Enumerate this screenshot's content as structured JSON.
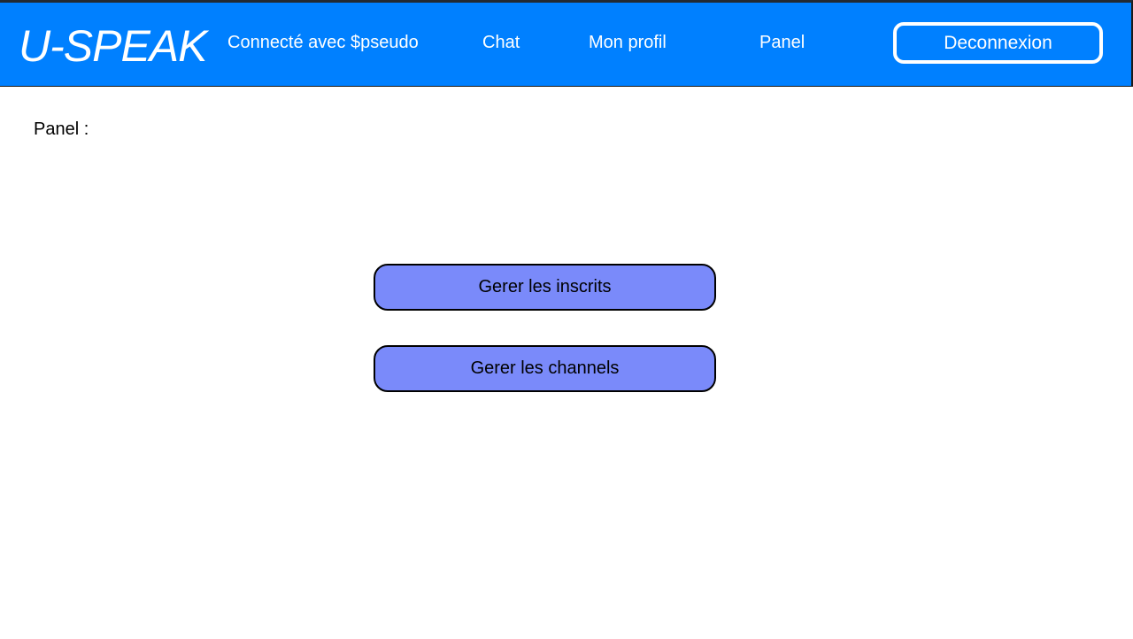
{
  "header": {
    "logo": "U-SPEAK",
    "connected_label": "Connecté avec $pseudo",
    "nav": {
      "chat": "Chat",
      "profil": "Mon profil",
      "panel": "Panel"
    },
    "logout_label": "Deconnexion"
  },
  "main": {
    "title": "Panel :",
    "actions": {
      "inscrits": "Gerer les inscrits",
      "channels": "Gerer les channels"
    }
  },
  "colors": {
    "header_bg": "#0080ff",
    "button_bg": "#7a8afa"
  }
}
